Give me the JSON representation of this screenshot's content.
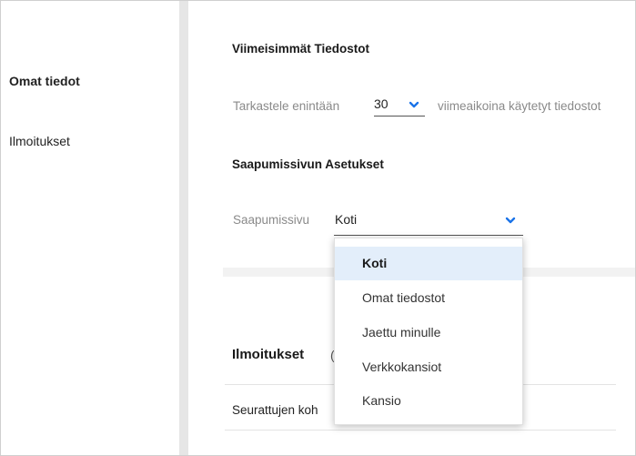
{
  "sidebar": {
    "items": [
      {
        "label": "Omat tiedot",
        "active": true
      },
      {
        "label": "Ilmoitukset",
        "active": false
      }
    ]
  },
  "recent_files": {
    "title": "Viimeisimmät Tiedostot",
    "prefix": "Tarkastele enintään",
    "count_value": "30",
    "suffix": "viimeaikoina käytetyt tiedostot"
  },
  "landing": {
    "title": "Saapumissivun Asetukset",
    "label": "Saapumissivu",
    "selected": "Koti",
    "options": [
      "Koti",
      "Omat tiedostot",
      "Jaettu minulle",
      "Verkkokansiot",
      "Kansio"
    ]
  },
  "notifications": {
    "title": "Ilmoitukset",
    "title_suffix": "(",
    "row_text": "Seurattujen koh"
  },
  "colors": {
    "accent": "#1a73e8",
    "selected_bg": "#e3eefa",
    "divider": "#e6e6e6"
  },
  "icons": {
    "dropdown": "chevron-down-icon"
  }
}
